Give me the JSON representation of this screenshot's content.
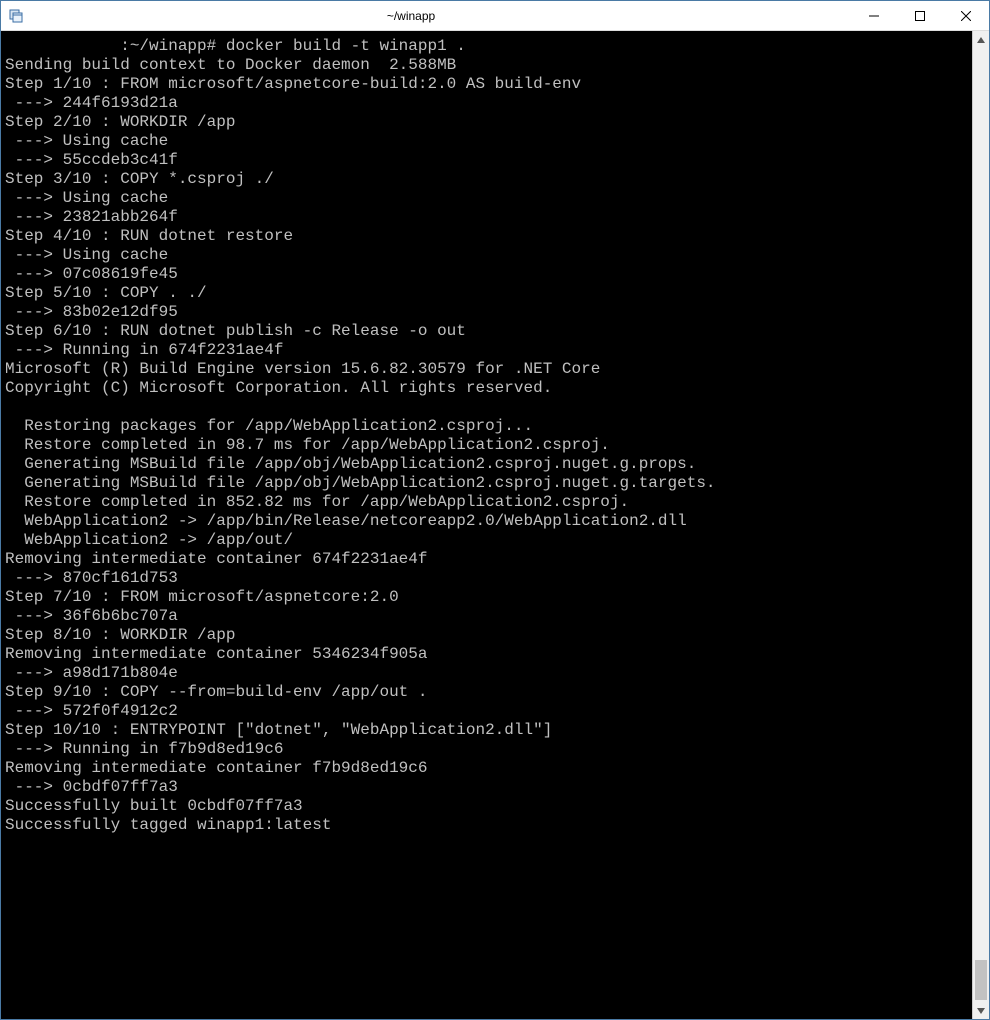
{
  "window": {
    "title": "~/winapp"
  },
  "terminal_lines": [
    "            :~/winapp# docker build -t winapp1 .",
    "Sending build context to Docker daemon  2.588MB",
    "Step 1/10 : FROM microsoft/aspnetcore-build:2.0 AS build-env",
    " ---> 244f6193d21a",
    "Step 2/10 : WORKDIR /app",
    " ---> Using cache",
    " ---> 55ccdeb3c41f",
    "Step 3/10 : COPY *.csproj ./",
    " ---> Using cache",
    " ---> 23821abb264f",
    "Step 4/10 : RUN dotnet restore",
    " ---> Using cache",
    " ---> 07c08619fe45",
    "Step 5/10 : COPY . ./",
    " ---> 83b02e12df95",
    "Step 6/10 : RUN dotnet publish -c Release -o out",
    " ---> Running in 674f2231ae4f",
    "Microsoft (R) Build Engine version 15.6.82.30579 for .NET Core",
    "Copyright (C) Microsoft Corporation. All rights reserved.",
    "",
    "  Restoring packages for /app/WebApplication2.csproj...",
    "  Restore completed in 98.7 ms for /app/WebApplication2.csproj.",
    "  Generating MSBuild file /app/obj/WebApplication2.csproj.nuget.g.props.",
    "  Generating MSBuild file /app/obj/WebApplication2.csproj.nuget.g.targets.",
    "  Restore completed in 852.82 ms for /app/WebApplication2.csproj.",
    "  WebApplication2 -> /app/bin/Release/netcoreapp2.0/WebApplication2.dll",
    "  WebApplication2 -> /app/out/",
    "Removing intermediate container 674f2231ae4f",
    " ---> 870cf161d753",
    "Step 7/10 : FROM microsoft/aspnetcore:2.0",
    " ---> 36f6b6bc707a",
    "Step 8/10 : WORKDIR /app",
    "Removing intermediate container 5346234f905a",
    " ---> a98d171b804e",
    "Step 9/10 : COPY --from=build-env /app/out .",
    " ---> 572f0f4912c2",
    "Step 10/10 : ENTRYPOINT [\"dotnet\", \"WebApplication2.dll\"]",
    " ---> Running in f7b9d8ed19c6",
    "Removing intermediate container f7b9d8ed19c6",
    " ---> 0cbdf07ff7a3",
    "Successfully built 0cbdf07ff7a3",
    "Successfully tagged winapp1:latest"
  ]
}
